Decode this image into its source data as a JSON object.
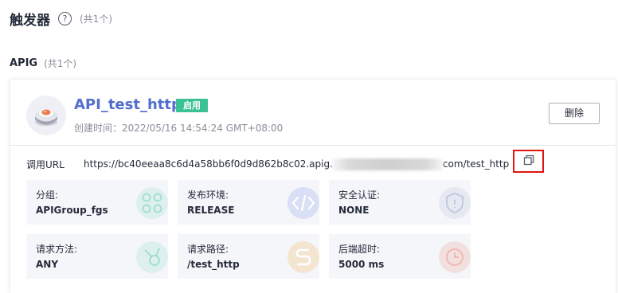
{
  "header": {
    "title": "触发器",
    "count": "(共1个)"
  },
  "section": {
    "title": "APIG",
    "count": "(共1个)"
  },
  "card": {
    "api_name": "API_test_http",
    "status": "启用",
    "created": "创建时间：2022/05/16 14:54:24 GMT+08:00",
    "delete_label": "删除",
    "url_label": "调用URL",
    "url_prefix": "https://bc40eeaa8c6d4a58bb6f0d9d862b8c02.apig.",
    "url_suffix": "com/test_http",
    "tiles": [
      {
        "label": "分组:",
        "value": "APIGroup_fgs",
        "icon": "group-icon",
        "color": "#3ac295"
      },
      {
        "label": "发布环境:",
        "value": "RELEASE",
        "icon": "code-icon",
        "color": "#5e7ce0"
      },
      {
        "label": "安全认证:",
        "value": "NONE",
        "icon": "shield-icon",
        "color": "#7f8fbf"
      },
      {
        "label": "请求方法:",
        "value": "ANY",
        "icon": "method-icon",
        "color": "#3ac295"
      },
      {
        "label": "请求路径:",
        "value": "/test_http",
        "icon": "path-icon",
        "color": "#f2a93a"
      },
      {
        "label": "后端超时:",
        "value": "5000 ms",
        "icon": "clock-icon",
        "color": "#e8806a"
      }
    ]
  }
}
